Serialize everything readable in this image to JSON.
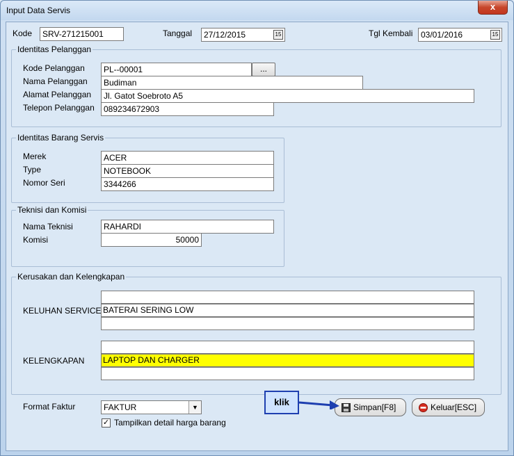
{
  "window": {
    "title": "Input Data Servis",
    "close_label": "x"
  },
  "header": {
    "kode_label": "Kode",
    "kode_value": "SRV-271215001",
    "tanggal_label": "Tanggal",
    "tanggal_value": "27/12/2015",
    "kembali_label": "Tgl Kembali",
    "kembali_value": "03/01/2016"
  },
  "pelanggan": {
    "title": "Identitas Pelanggan",
    "kode_label": "Kode Pelanggan",
    "kode_value": "PL--00001",
    "browse_label": "...",
    "nama_label": "Nama Pelanggan",
    "nama_value": "Budiman",
    "alamat_label": "Alamat Pelanggan",
    "alamat_value": "Jl. Gatot Soebroto A5",
    "telepon_label": "Telepon Pelanggan",
    "telepon_value": "089234672903"
  },
  "barang": {
    "title": "Identitas Barang Servis",
    "merek_label": "Merek",
    "merek_value": "ACER",
    "type_label": "Type",
    "type_value": "NOTEBOOK",
    "seri_label": "Nomor Seri",
    "seri_value": "3344266"
  },
  "teknisi": {
    "title": "Teknisi dan Komisi",
    "nama_label": "Nama Teknisi",
    "nama_value": "RAHARDI",
    "komisi_label": "Komisi",
    "komisi_value": "50000"
  },
  "kerusakan": {
    "title": "Kerusakan dan Kelengkapan",
    "keluhan_label": "KELUHAN SERVICE",
    "keluhan_value": "BATERAI SERING LOW",
    "kelengkapan_label": "KELENGKAPAN",
    "kelengkapan_value": "LAPTOP DAN CHARGER"
  },
  "footer": {
    "format_label": "Format Faktur",
    "format_value": "FAKTUR",
    "checkbox_label": "Tampilkan detail harga barang",
    "checkbox_checked": true,
    "save_label": "Simpan[F8]",
    "exit_label": "Keluar[ESC]",
    "annotation": "klik"
  },
  "colors": {
    "highlight": "#ffff00",
    "annotation_border": "#1e3fb0",
    "arrow": "#1e3fb0"
  },
  "icons": [
    "close-icon",
    "calendar-icon",
    "save-disk-icon",
    "exit-icon",
    "dropdown-arrow-icon",
    "checkmark-icon"
  ]
}
